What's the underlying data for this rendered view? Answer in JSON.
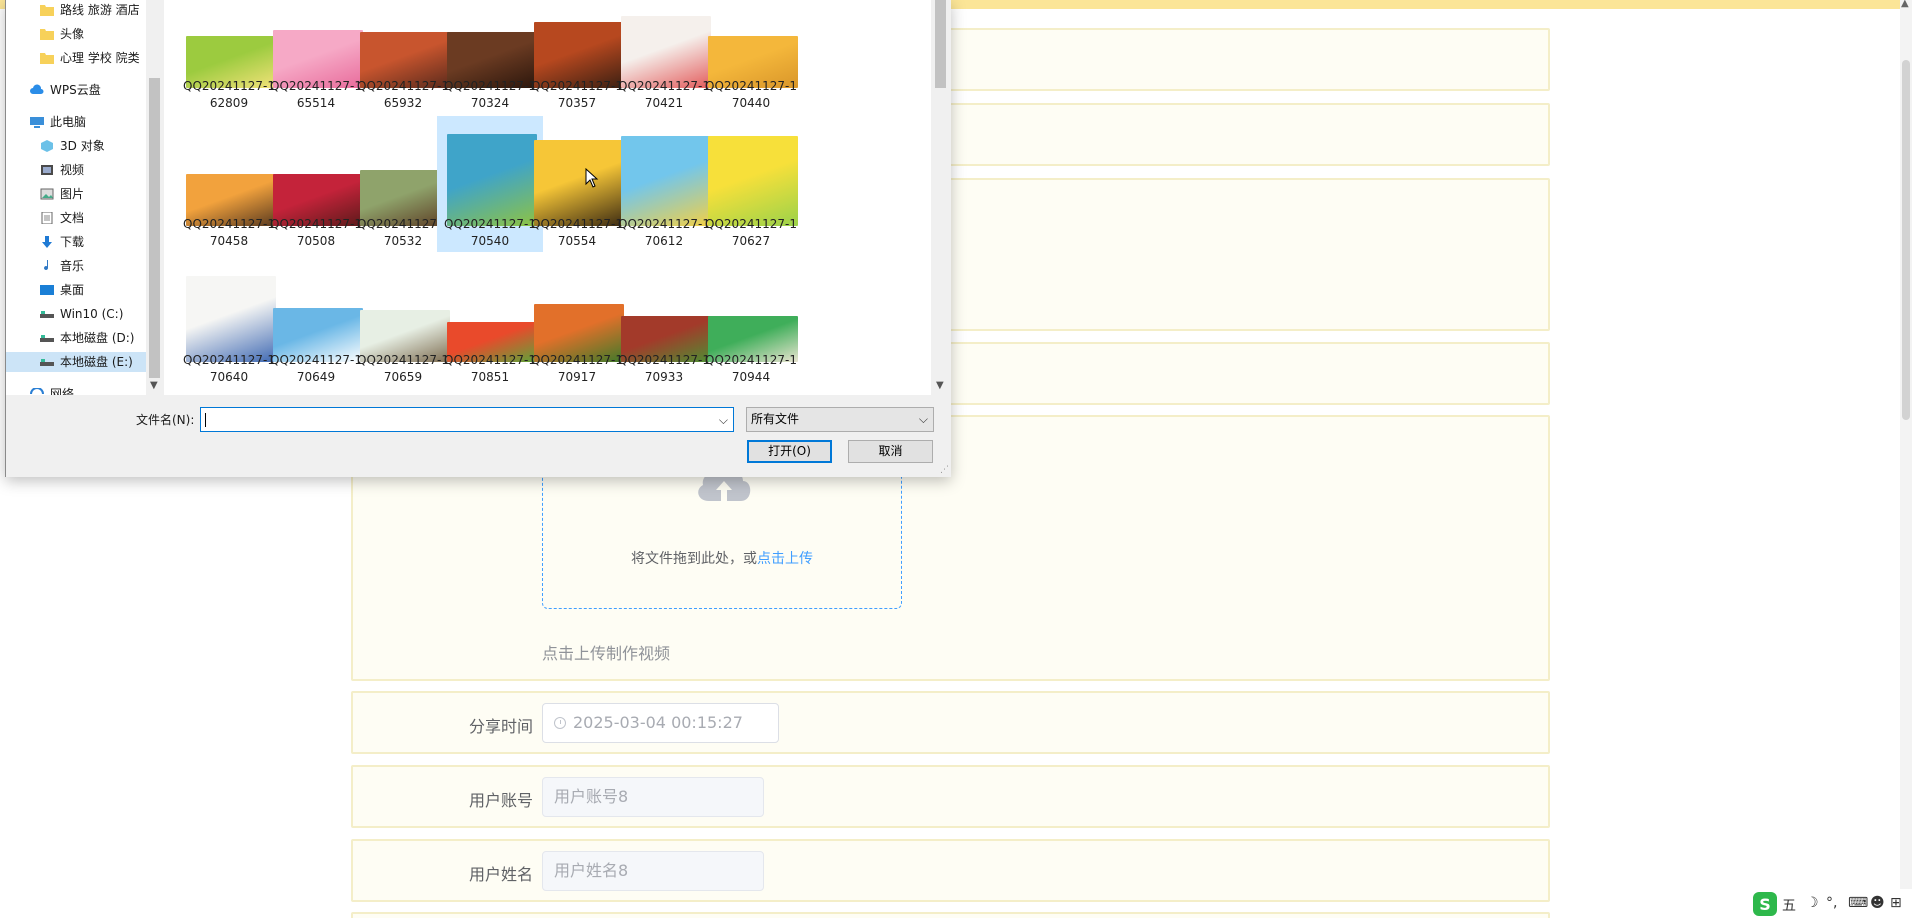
{
  "form": {
    "upload": {
      "text": "将文件拖到此处，或",
      "link": "点击上传",
      "tip": "点击上传制作视频"
    },
    "share_time": {
      "label": "分享时间",
      "value": "2025-03-04 00:15:27"
    },
    "account": {
      "label": "用户账号",
      "value": "用户账号8"
    },
    "name": {
      "label": "用户姓名",
      "value": "用户姓名8"
    }
  },
  "dialog": {
    "nav": [
      {
        "label": "路线 旅游 酒店",
        "icon": "folder-icon"
      },
      {
        "label": "头像",
        "icon": "folder-icon"
      },
      {
        "label": "心理 学校 院类",
        "icon": "folder-icon"
      },
      {
        "label": "WPS云盘",
        "icon": "cloud-icon"
      },
      {
        "label": "此电脑",
        "icon": "computer-icon"
      },
      {
        "label": "3D 对象",
        "icon": "cube-icon"
      },
      {
        "label": "视频",
        "icon": "video-icon"
      },
      {
        "label": "图片",
        "icon": "picture-icon"
      },
      {
        "label": "文档",
        "icon": "document-icon"
      },
      {
        "label": "下载",
        "icon": "download-icon"
      },
      {
        "label": "音乐",
        "icon": "music-icon"
      },
      {
        "label": "桌面",
        "icon": "desktop-icon"
      },
      {
        "label": "Win10 (C:)",
        "icon": "drive-icon"
      },
      {
        "label": "本地磁盘 (D:)",
        "icon": "drive-icon"
      },
      {
        "label": "本地磁盘 (E:)",
        "icon": "drive-icon"
      },
      {
        "label": "网络",
        "icon": "network-icon"
      }
    ],
    "files": [
      {
        "line1": "QQ20241127-1",
        "line2": "62809",
        "colors": [
          "#9ccb3f",
          "#f3e27a"
        ]
      },
      {
        "line1": "QQ20241127-1",
        "line2": "65514",
        "colors": [
          "#f6a9c6",
          "#e86b9b"
        ]
      },
      {
        "line1": "QQ20241127-1",
        "line2": "65932",
        "colors": [
          "#c8552e",
          "#5a2a1c"
        ]
      },
      {
        "line1": "QQ20241127-1",
        "line2": "70324",
        "colors": [
          "#6b3b22",
          "#2b160c"
        ]
      },
      {
        "line1": "QQ20241127-1",
        "line2": "70357",
        "colors": [
          "#b7481f",
          "#3a1f12"
        ]
      },
      {
        "line1": "QQ20241127-1",
        "line2": "70421",
        "colors": [
          "#f5f0ec",
          "#e35b5b"
        ]
      },
      {
        "line1": "QQ20241127-1",
        "line2": "70440",
        "colors": [
          "#f4b73b",
          "#d9962a"
        ]
      },
      {
        "line1": "QQ20241127-1",
        "line2": "70458",
        "colors": [
          "#f2a23d",
          "#5a3a1f"
        ]
      },
      {
        "line1": "QQ20241127-1",
        "line2": "70508",
        "colors": [
          "#c4233a",
          "#5b1a1a"
        ]
      },
      {
        "line1": "QQ20241127-1",
        "line2": "70532",
        "colors": [
          "#8fa36b",
          "#5b3b23"
        ]
      },
      {
        "line1": "QQ20241127-1",
        "line2": "70540",
        "colors": [
          "#3fa4c9",
          "#8ec342"
        ]
      },
      {
        "line1": "QQ20241127-1",
        "line2": "70554",
        "colors": [
          "#f6c637",
          "#3b2a12"
        ]
      },
      {
        "line1": "QQ20241127-1",
        "line2": "70612",
        "colors": [
          "#72c6ec",
          "#f2d046"
        ]
      },
      {
        "line1": "QQ20241127-1",
        "line2": "70627",
        "colors": [
          "#f7e03a",
          "#9bd24a"
        ]
      },
      {
        "line1": "QQ20241127-1",
        "line2": "70640",
        "colors": [
          "#f6f6f4",
          "#3f69b3"
        ]
      },
      {
        "line1": "QQ20241127-1",
        "line2": "70649",
        "colors": [
          "#6ab7e6",
          "#ffffff"
        ]
      },
      {
        "line1": "QQ20241127-1",
        "line2": "70659",
        "colors": [
          "#e7efe4",
          "#7c6b4f"
        ]
      },
      {
        "line1": "QQ20241127-1",
        "line2": "70851",
        "colors": [
          "#e94a2b",
          "#5ea53a"
        ]
      },
      {
        "line1": "QQ20241127-1",
        "line2": "70917",
        "colors": [
          "#e2702a",
          "#3f7a2a"
        ]
      },
      {
        "line1": "QQ20241127-1",
        "line2": "70933",
        "colors": [
          "#a33a2a",
          "#4e8f33"
        ]
      },
      {
        "line1": "QQ20241127-1",
        "line2": "70944",
        "colors": [
          "#3fae5a",
          "#e9e4d0"
        ]
      }
    ],
    "selected_file": "70540",
    "filename_label": "文件名(N):",
    "filename_value": "",
    "filetype": "所有文件",
    "open_label": "打开(O)",
    "cancel_label": "取消"
  },
  "tray": {
    "ime": "五",
    "moon": "☽",
    "dot": "°,",
    "kb": "⌨",
    "user": "☻",
    "grid": "⊞"
  },
  "colors": {
    "accent": "#409eff",
    "topbar": "#fbe597",
    "row_bg": "#fefdf4",
    "row_border": "#f4eec8",
    "selection": "#cce8ff"
  }
}
